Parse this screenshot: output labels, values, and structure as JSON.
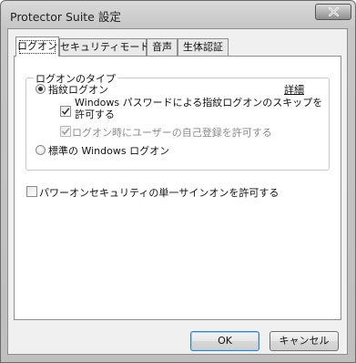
{
  "window": {
    "title": "Protector Suite 設定"
  },
  "tabs": [
    {
      "label": "ログオン",
      "active": true
    },
    {
      "label": "セキュリティモード",
      "active": false
    },
    {
      "label": "音声",
      "active": false
    },
    {
      "label": "生体認証",
      "active": false
    }
  ],
  "logon_type": {
    "group_label": "ログオンのタイプ",
    "fingerprint_radio": {
      "label": "指紋ログオン",
      "checked": true
    },
    "details_link": "詳細",
    "skip_password_checkbox": {
      "line1": "Windows パスワードによる指紋ログオンのスキップを",
      "line2": "許可する",
      "checked": true
    },
    "self_register_checkbox": {
      "label": "ログオン時にユーザーの自己登録を許可する",
      "checked": true,
      "enabled": false
    },
    "standard_radio": {
      "label": "標準の Windows ログオン",
      "checked": false
    }
  },
  "sso_checkbox": {
    "label": "パワーオンセキュリティの単一サインオンを許可する",
    "checked": false
  },
  "buttons": {
    "ok": "OK",
    "cancel": "キャンセル"
  },
  "icons": {
    "close": "close-icon",
    "check": "check-icon"
  }
}
